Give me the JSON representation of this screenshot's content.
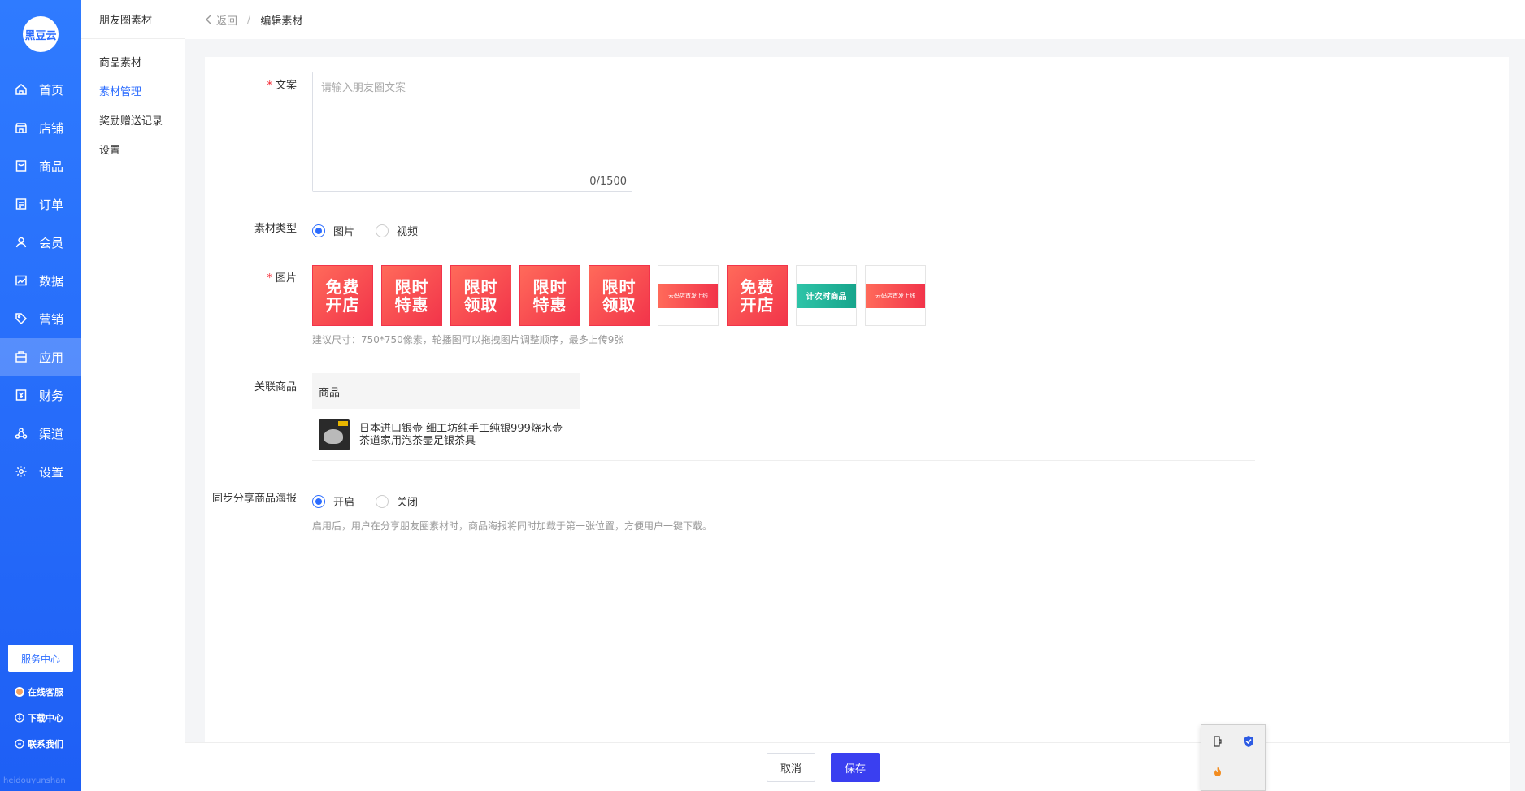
{
  "sidebar": {
    "logo": "黑豆云",
    "items": [
      {
        "label": "首页",
        "icon": "home-icon"
      },
      {
        "label": "店铺",
        "icon": "store-icon"
      },
      {
        "label": "商品",
        "icon": "goods-icon"
      },
      {
        "label": "订单",
        "icon": "order-icon"
      },
      {
        "label": "会员",
        "icon": "member-icon"
      },
      {
        "label": "数据",
        "icon": "chart-icon"
      },
      {
        "label": "营销",
        "icon": "tag-icon"
      },
      {
        "label": "应用",
        "icon": "app-icon"
      },
      {
        "label": "财务",
        "icon": "finance-icon"
      },
      {
        "label": "渠道",
        "icon": "channel-icon"
      },
      {
        "label": "设置",
        "icon": "gear-icon"
      }
    ],
    "service_center": "服务中心",
    "online_service": "在线客服",
    "download_center": "下载中心",
    "contact_us": "联系我们",
    "footer": "heidouyunshan"
  },
  "subnav": {
    "title": "朋友圈素材",
    "items": [
      "商品素材",
      "素材管理",
      "奖励赠送记录",
      "设置"
    ],
    "active_index": 1
  },
  "header": {
    "back_label": "返回",
    "separator": "/",
    "current": "编辑素材"
  },
  "form": {
    "copy_label": "文案",
    "copy_placeholder": "请输入朋友圈文案",
    "copy_value": "",
    "copy_counter": "0/1500",
    "type_label": "素材类型",
    "type_options": [
      "图片",
      "视频"
    ],
    "type_selected": "图片",
    "image_label": "图片",
    "images": [
      {
        "text": "免费开店",
        "style": "red"
      },
      {
        "text": "限时特惠",
        "style": "red"
      },
      {
        "text": "限时领取",
        "style": "red"
      },
      {
        "text": "限时特惠",
        "style": "red"
      },
      {
        "text": "限时领取",
        "style": "red"
      },
      {
        "text": "云码店首发上线",
        "style": "white"
      },
      {
        "text": "免费开店",
        "style": "red"
      },
      {
        "text": "计次时商品",
        "style": "green"
      },
      {
        "text": "云码店首发上线",
        "style": "white"
      }
    ],
    "image_hint": "建议尺寸：750*750像素，轮播图可以拖拽图片调整顺序，最多上传9张",
    "goods_label": "关联商品",
    "goods_header": "商品",
    "goods_name": "日本进口银壶 细工坊纯手工纯银999烧水壶茶道家用泡茶壶足银茶具",
    "sync_label": "同步分享商品海报",
    "sync_options": [
      "开启",
      "关闭"
    ],
    "sync_selected": "开启",
    "sync_hint": "启用后，用户在分享朋友圈素材时，商品海报将同时加载于第一张位置，方便用户一键下载。"
  },
  "actions": {
    "cancel": "取消",
    "save": "保存"
  },
  "colors": {
    "primary": "#2b6cff",
    "save_button": "#3a3ff0",
    "required": "#f5222d"
  }
}
